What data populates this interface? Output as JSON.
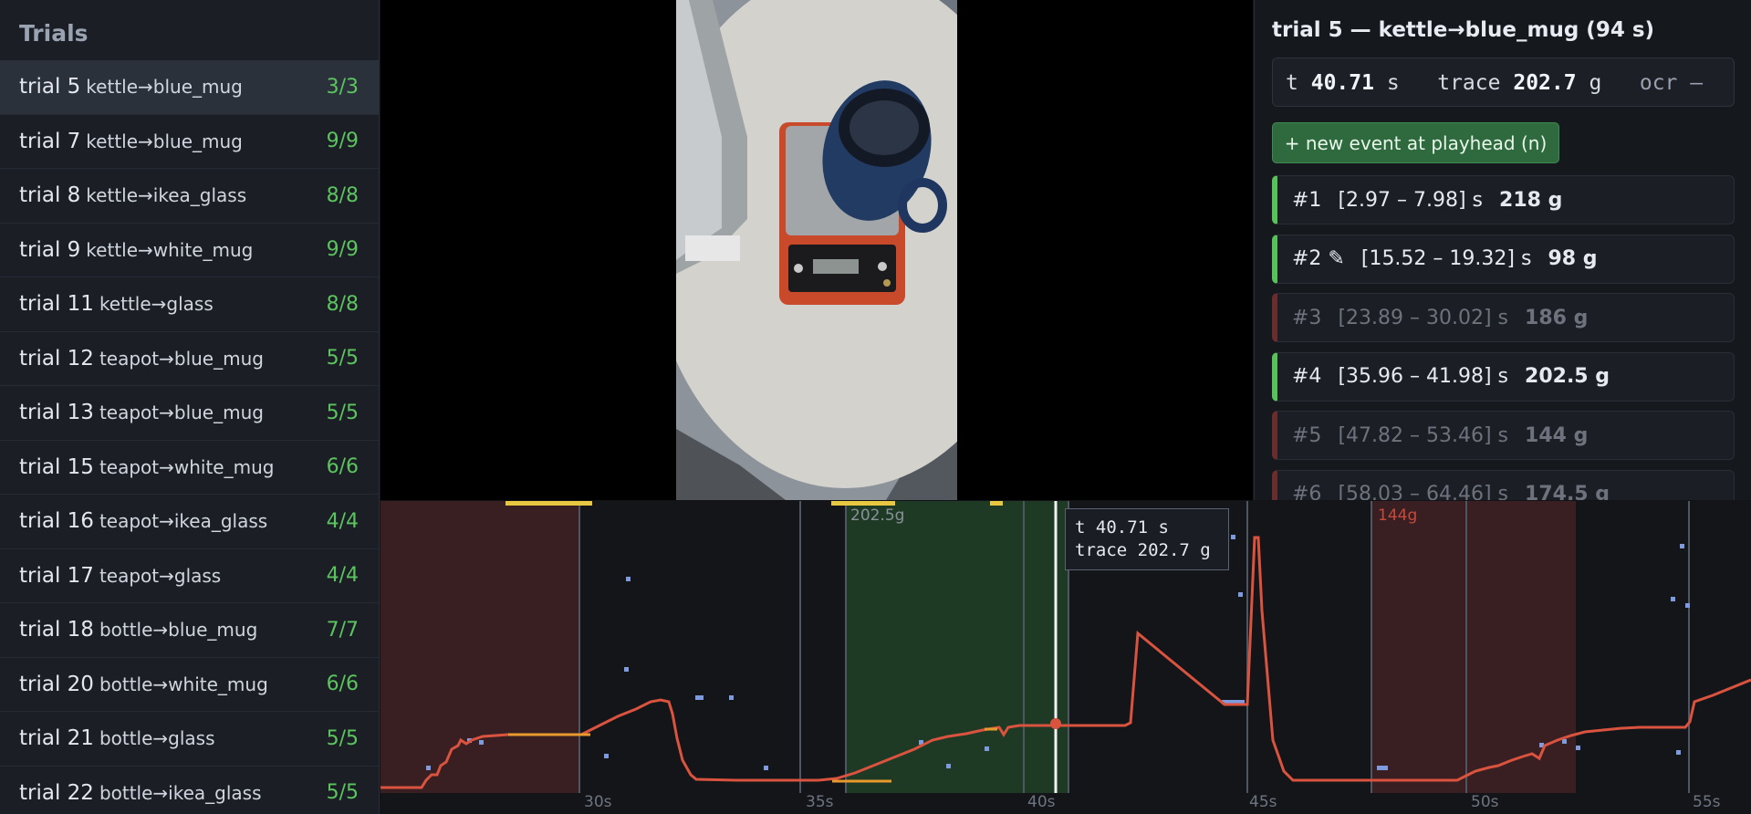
{
  "sidebar": {
    "title": "Trials",
    "items": [
      {
        "name": "trial 5",
        "sub": "kettle→blue_mug",
        "count": "3/3"
      },
      {
        "name": "trial 7",
        "sub": "kettle→blue_mug",
        "count": "9/9"
      },
      {
        "name": "trial 8",
        "sub": "kettle→ikea_glass",
        "count": "8/8"
      },
      {
        "name": "trial 9",
        "sub": "kettle→white_mug",
        "count": "9/9"
      },
      {
        "name": "trial 11",
        "sub": "kettle→glass",
        "count": "8/8"
      },
      {
        "name": "trial 12",
        "sub": "teapot→blue_mug",
        "count": "5/5"
      },
      {
        "name": "trial 13",
        "sub": "teapot→blue_mug",
        "count": "5/5"
      },
      {
        "name": "trial 15",
        "sub": "teapot→white_mug",
        "count": "6/6"
      },
      {
        "name": "trial 16",
        "sub": "teapot→ikea_glass",
        "count": "4/4"
      },
      {
        "name": "trial 17",
        "sub": "teapot→glass",
        "count": "4/4"
      },
      {
        "name": "trial 18",
        "sub": "bottle→blue_mug",
        "count": "7/7"
      },
      {
        "name": "trial 20",
        "sub": "bottle→white_mug",
        "count": "6/6"
      },
      {
        "name": "trial 21",
        "sub": "bottle→glass",
        "count": "5/5"
      },
      {
        "name": "trial 22",
        "sub": "bottle→ikea_glass",
        "count": "5/5"
      }
    ]
  },
  "panel": {
    "title": "trial 5 — kettle→blue_mug (94 s)",
    "readout": {
      "t_label": "t",
      "t_value": "40.71",
      "t_unit": "s",
      "trace_label": "trace",
      "trace_value": "202.7",
      "trace_unit": "g",
      "ocr_label": "ocr",
      "ocr_value": "–"
    },
    "new_event_button": "+ new event at playhead (n)",
    "events": [
      {
        "id": "#1",
        "range": "[2.97 – 7.98] s",
        "grams": "218 g",
        "accepted": true
      },
      {
        "id": "#2 ✎",
        "range": "[15.52 – 19.32] s",
        "grams": "98 g",
        "accepted": true
      },
      {
        "id": "#3",
        "range": "[23.89 – 30.02] s",
        "grams": "186 g",
        "accepted": false
      },
      {
        "id": "#4",
        "range": "[35.96 – 41.98] s",
        "grams": "202.5 g",
        "accepted": true
      },
      {
        "id": "#5",
        "range": "[47.82 – 53.46] s",
        "grams": "144 g",
        "accepted": false
      },
      {
        "id": "#6",
        "range": "[58.03 – 64.46] s",
        "grams": "174.5 g",
        "accepted": false
      }
    ]
  },
  "timeline": {
    "tooltip_line1": "t 40.71 s",
    "tooltip_line2": "trace 202.7 g",
    "region_labels": [
      "202.5g",
      "144g"
    ],
    "ticks": [
      "30s",
      "35s",
      "40s",
      "45s",
      "50s",
      "55s"
    ],
    "colors": {
      "trace": "#d9533f",
      "ocr_points": "#7f9be0",
      "accepted_region": "#1e3a25",
      "rejected_region": "#3a1f22",
      "marker": "#e8c840"
    }
  }
}
